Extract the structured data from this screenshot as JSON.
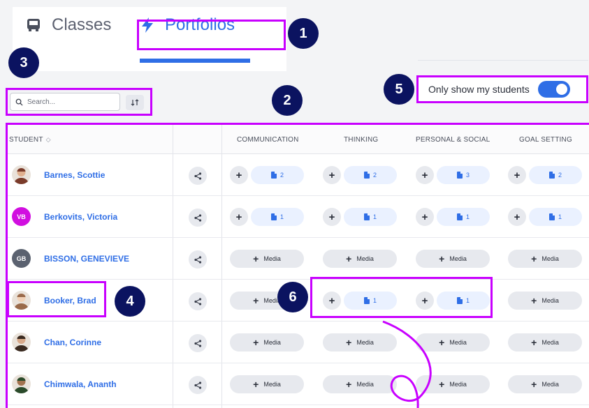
{
  "tabs": [
    {
      "label": "Classes",
      "icon": "bus-icon",
      "active": false
    },
    {
      "label": "Portfolios",
      "icon": "lightning-icon",
      "active": true
    }
  ],
  "badges": [
    "1",
    "2",
    "3",
    "4",
    "5",
    "6"
  ],
  "search": {
    "placeholder": "Search..."
  },
  "toggle": {
    "label": "Only show my students",
    "on": true
  },
  "table": {
    "student_header": "STUDENT",
    "columns": [
      "COMMUNICATION",
      "THINKING",
      "PERSONAL & SOCIAL",
      "GOAL SETTING"
    ],
    "media_label": "Media",
    "rows": [
      {
        "name": "Barnes, Scottie",
        "avatar": "photo",
        "cells": [
          "2",
          "2",
          "3",
          "2"
        ]
      },
      {
        "name": "Berkovits, Victoria",
        "avatar": "VB",
        "avatar_color": "#d10fe0",
        "cells": [
          "1",
          "1",
          "1",
          "1"
        ]
      },
      {
        "name": "BISSON, GENEVIEVE",
        "avatar": "GB",
        "avatar_color": "#5b6270",
        "cells": [
          null,
          null,
          null,
          null
        ]
      },
      {
        "name": "Booker, Brad",
        "avatar": "photo",
        "cells": [
          null,
          "1",
          "1",
          null
        ]
      },
      {
        "name": "Chan, Corinne",
        "avatar": "photo",
        "cells": [
          null,
          null,
          null,
          null
        ]
      },
      {
        "name": "Chimwala, Ananth",
        "avatar": "photo",
        "cells": [
          null,
          null,
          null,
          null
        ]
      }
    ]
  },
  "colors": {
    "accent": "#2f6ee6",
    "highlight": "#c800ff",
    "badge": "#0b1360"
  }
}
